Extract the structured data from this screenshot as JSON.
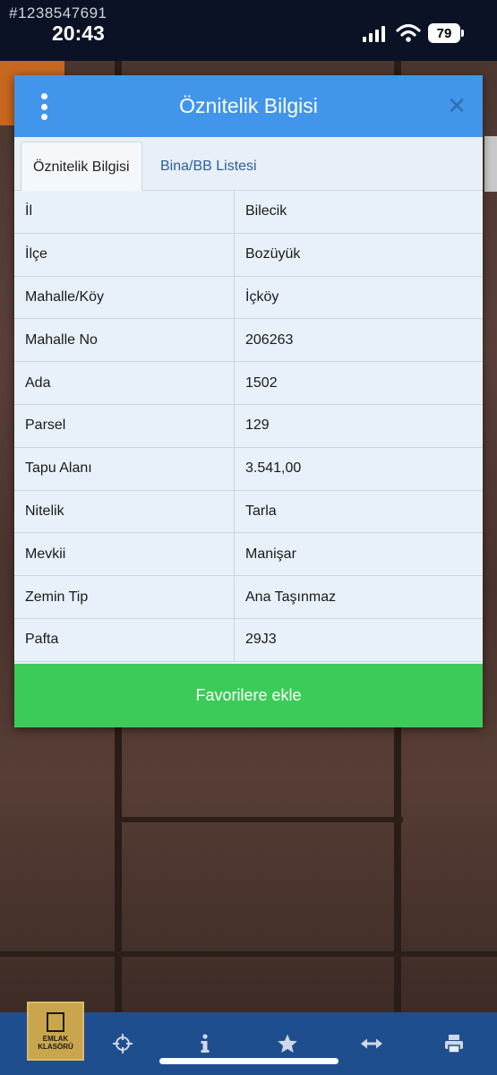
{
  "status_bar": {
    "watermark_id": "#1238547691",
    "time": "20:43",
    "battery": "79"
  },
  "dialog": {
    "title": "Öznitelik Bilgisi",
    "tabs": [
      {
        "label": "Öznitelik Bilgisi",
        "active": true
      },
      {
        "label": "Bina/BB Listesi",
        "active": false
      }
    ],
    "rows": [
      {
        "key": "İl",
        "value": "Bilecik"
      },
      {
        "key": "İlçe",
        "value": "Bozüyük"
      },
      {
        "key": "Mahalle/Köy",
        "value": "İçköy"
      },
      {
        "key": "Mahalle No",
        "value": "206263"
      },
      {
        "key": "Ada",
        "value": "1502"
      },
      {
        "key": "Parsel",
        "value": "129"
      },
      {
        "key": "Tapu Alanı",
        "value": "3.541,00"
      },
      {
        "key": "Nitelik",
        "value": "Tarla"
      },
      {
        "key": "Mevkii",
        "value": "Manişar"
      },
      {
        "key": "Zemin Tip",
        "value": "Ana Taşınmaz"
      },
      {
        "key": "Pafta",
        "value": "29J3"
      }
    ],
    "favorite_button": "Favorilere ekle"
  },
  "toolbar": {
    "logo_line1": "EMLAK",
    "logo_line2": "KLASÖRÜ",
    "icons": [
      "crosshair-icon",
      "info-icon",
      "star-icon",
      "measure-icon",
      "print-icon"
    ]
  },
  "colors": {
    "header_blue": "#4195ea",
    "favorite_green": "#3ccb58",
    "toolbar_blue": "#1f4e8e"
  }
}
